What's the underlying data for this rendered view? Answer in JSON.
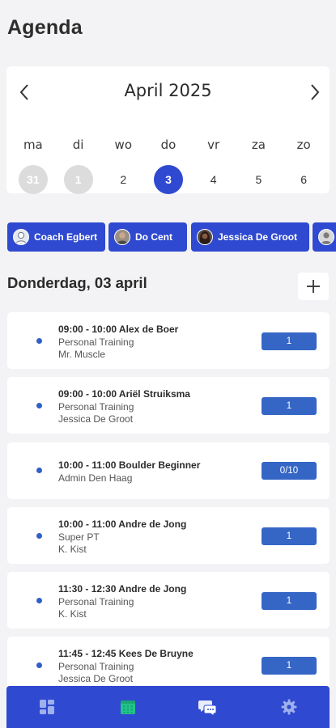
{
  "page": {
    "title": "Agenda"
  },
  "calendar": {
    "month": "April 2025",
    "weekdays": [
      "ma",
      "di",
      "wo",
      "do",
      "vr",
      "za",
      "zo"
    ],
    "days": [
      "31",
      "1",
      "2",
      "3",
      "4",
      "5",
      "6"
    ],
    "selected": "3"
  },
  "coaches": [
    {
      "name": "Coach Egbert"
    },
    {
      "name": "Do Cent"
    },
    {
      "name": "Jessica De Groot"
    }
  ],
  "day_heading": "Donderdag, 03 april",
  "appointments": [
    {
      "title": "09:00 - 10:00 Alex de Boer",
      "line1": "Personal Training",
      "line2": "Mr. Muscle",
      "badge": "1"
    },
    {
      "title": "09:00 - 10:00 Ariël Struiksma",
      "line1": "Personal Training",
      "line2": "Jessica De Groot",
      "badge": "1"
    },
    {
      "title": "10:00 - 11:00 Boulder Beginner",
      "line1": "Admin Den Haag",
      "line2": "",
      "badge": "0/10"
    },
    {
      "title": "10:00 - 11:00 Andre de Jong",
      "line1": "Super PT",
      "line2": "K. Kist",
      "badge": "1"
    },
    {
      "title": "11:30 - 12:30 Andre de Jong",
      "line1": "Personal Training",
      "line2": "K. Kist",
      "badge": "1"
    },
    {
      "title": "11:45 - 12:45 Kees De Bruyne",
      "line1": "Personal Training",
      "line2": "Jessica De Groot",
      "badge": "1"
    }
  ],
  "tabs": [
    {
      "icon": "dashboard-icon"
    },
    {
      "icon": "calendar-icon",
      "active": true
    },
    {
      "icon": "chat-icon"
    },
    {
      "icon": "settings-icon"
    }
  ],
  "colors": {
    "accent": "#2f49d0",
    "badge": "#3566c6",
    "active_tab_icon": "#22c48a"
  }
}
